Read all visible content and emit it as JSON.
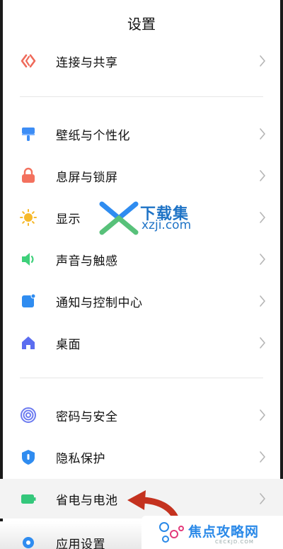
{
  "header": {
    "title": "设置"
  },
  "sections": {
    "connect": {
      "label": "连接与共享",
      "icon": "share-icon",
      "color": "#ef6a5a"
    },
    "wallpaper": {
      "label": "壁纸与个性化",
      "icon": "brush-icon",
      "color": "#3d8df5"
    },
    "lock": {
      "label": "息屏与锁屏",
      "icon": "lock-icon",
      "color": "#f3715e"
    },
    "display": {
      "label": "显示",
      "icon": "sun-icon",
      "color": "#f6b92b"
    },
    "sound": {
      "label": "声音与触感",
      "icon": "speaker-icon",
      "color": "#3ed07a"
    },
    "notify": {
      "label": "通知与控制中心",
      "icon": "notification-icon",
      "color": "#2f8cf0"
    },
    "desktop": {
      "label": "桌面",
      "icon": "home-icon",
      "color": "#5b6df0"
    },
    "password": {
      "label": "密码与安全",
      "icon": "fingerprint-icon",
      "color": "#6c7bf0"
    },
    "privacy": {
      "label": "隐私保护",
      "icon": "shield-icon",
      "color": "#2f8cf0"
    },
    "battery": {
      "label": "省电与电池",
      "icon": "battery-icon",
      "color": "#34c77b"
    },
    "apps": {
      "label": "应用设置",
      "icon": "gear-icon",
      "color": "#2f8cf0"
    }
  },
  "watermark": {
    "title": "下载集",
    "url": "xzji.com"
  },
  "badge": {
    "text": "焦点攻略网",
    "sub": "CECKJD.COM"
  }
}
